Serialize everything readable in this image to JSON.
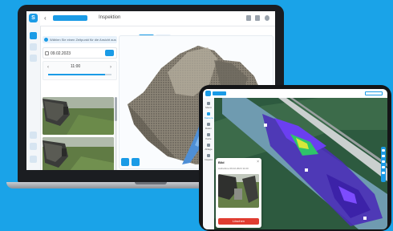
{
  "laptop": {
    "logo_glyph": "S",
    "topbar": {
      "back_glyph": "‹",
      "chip_label": "",
      "title": "Inspektion"
    },
    "info_bar_text": "Wählen Sie einen Zeitpunkt für die Ansicht aus",
    "date_value": "09.02.2023",
    "time": {
      "prev": "‹",
      "value": "11:00",
      "next": "›",
      "slider_fraction": 0.9
    },
    "tabs": [
      "3D Modell",
      "Fotos"
    ]
  },
  "tablet": {
    "chip_label": "",
    "right_chip_label": "",
    "sidebar": [
      {
        "label": "Menü"
      },
      {
        "label": "Kamera"
      },
      {
        "label": "Daten"
      },
      {
        "label": "Karte"
      },
      {
        "label": "Ablage"
      },
      {
        "label": "Inspekt."
      }
    ],
    "popup": {
      "title": "Bild",
      "close_glyph": "×",
      "meta": "Aufnahme   09.02.2023 11:00",
      "action_label": "Löschen"
    }
  },
  "colors": {
    "brand": "#1a9be6",
    "danger": "#e03c31",
    "background": "#1aa3e8"
  }
}
